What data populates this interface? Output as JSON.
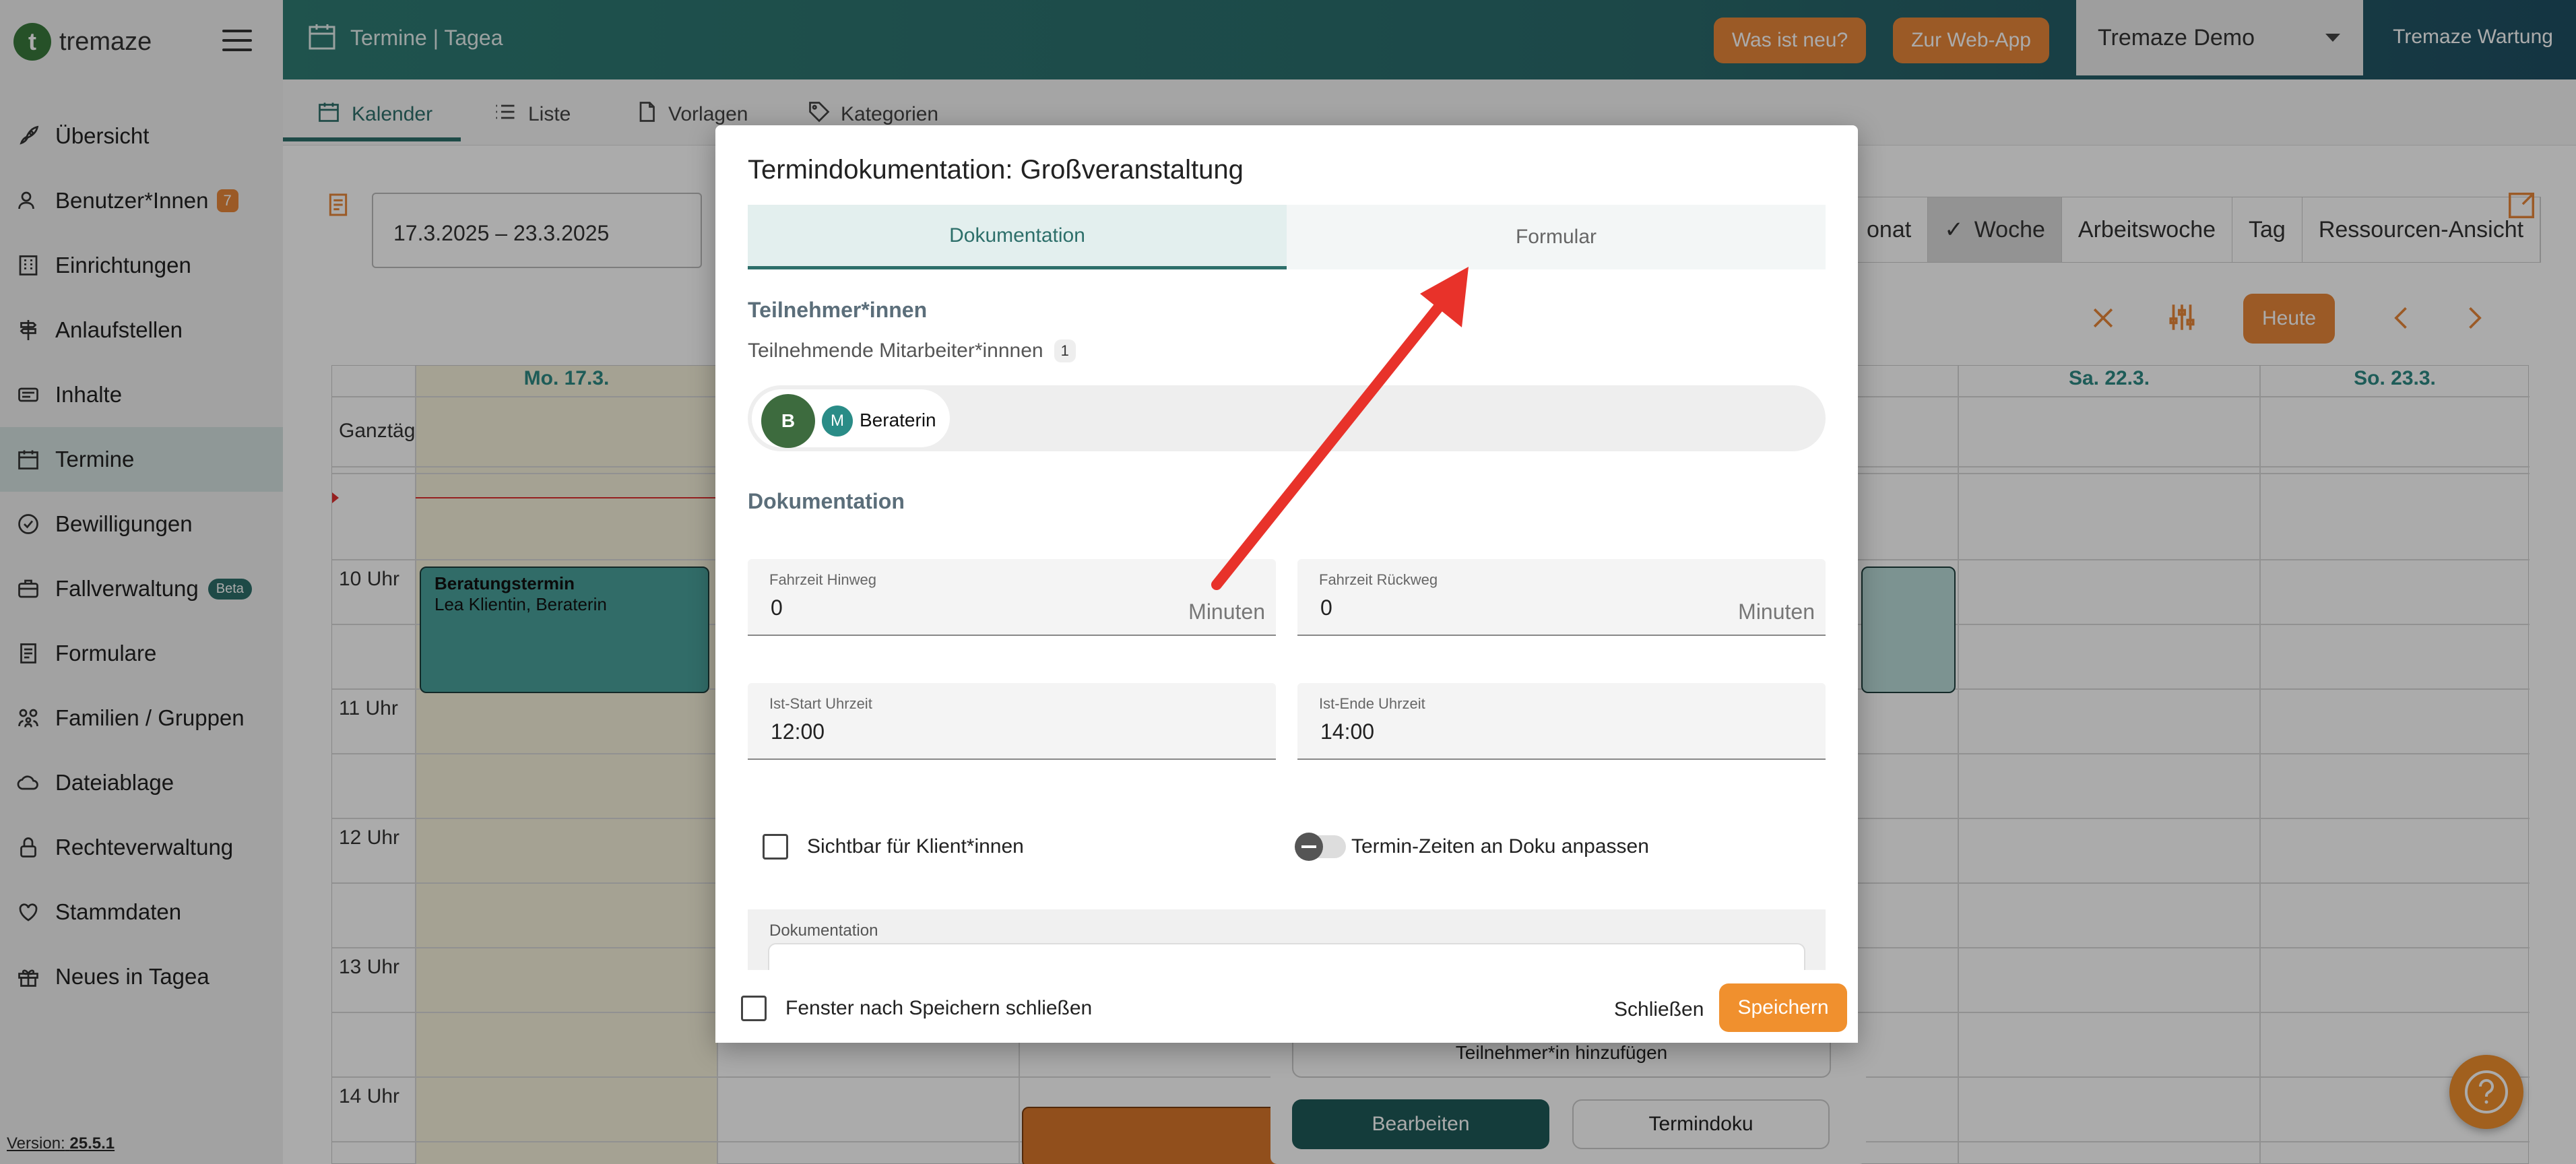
{
  "sidebar": {
    "logo_text": "tremaze",
    "logo_letter": "t",
    "items": [
      {
        "label": "Übersicht",
        "icon": "rocket-icon"
      },
      {
        "label": "Benutzer*Innen",
        "icon": "users-icon",
        "badge": "7"
      },
      {
        "label": "Einrichtungen",
        "icon": "building-icon"
      },
      {
        "label": "Anlaufstellen",
        "icon": "signpost-icon"
      },
      {
        "label": "Inhalte",
        "icon": "content-icon"
      },
      {
        "label": "Termine",
        "icon": "calendar-icon",
        "active": true
      },
      {
        "label": "Bewilligungen",
        "icon": "check-circle-icon"
      },
      {
        "label": "Fallverwaltung",
        "icon": "briefcase-icon",
        "badge": "Beta"
      },
      {
        "label": "Formulare",
        "icon": "form-icon"
      },
      {
        "label": "Familien / Gruppen",
        "icon": "family-icon"
      },
      {
        "label": "Dateiablage",
        "icon": "cloud-icon"
      },
      {
        "label": "Rechteverwaltung",
        "icon": "lock-icon"
      },
      {
        "label": "Stammdaten",
        "icon": "heart-icon"
      },
      {
        "label": "Neues in Tagea",
        "icon": "gift-icon"
      }
    ],
    "version_label": "Version:",
    "version_value": "25.5.1"
  },
  "header": {
    "title": "Termine | Tagea",
    "whats_new": "Was ist neu?",
    "web_app": "Zur Web-App",
    "org_select": "Tremaze Demo",
    "maintenance": "Tremaze Wartung"
  },
  "subtabs": [
    "Kalender",
    "Liste",
    "Vorlagen",
    "Kategorien"
  ],
  "calendar": {
    "date_range": "17.3.2025 – 23.3.2025",
    "views": [
      "onat",
      "Woche",
      "Arbeitswoche",
      "Tag",
      "Ressourcen-Ansicht"
    ],
    "today": "Heute",
    "days": [
      "Mo. 17.3.",
      "Sa. 22.3.",
      "So. 23.3."
    ],
    "allday_label": "Ganztäg",
    "hours": [
      "10 Uhr",
      "11 Uhr",
      "12 Uhr",
      "13 Uhr",
      "14 Uhr"
    ],
    "event_title": "Beratungstermin",
    "event_sub": "Lea Klientin, Beraterin"
  },
  "popover": {
    "add_participant": "Teilnehmer*in hinzufügen",
    "edit": "Bearbeiten",
    "doc": "Termindoku"
  },
  "modal": {
    "title": "Termindokumentation: Großveranstaltung",
    "tabs": [
      "Dokumentation",
      "Formular"
    ],
    "participants_title": "Teilnehmer*innen",
    "staff_label": "Teilnehmende Mitarbeiter*innnen",
    "staff_count": "1",
    "avatar_b": "B",
    "avatar_m": "M",
    "participant_name": "Beraterin",
    "doc_title": "Dokumentation",
    "travel_to_label": "Fahrzeit Hinweg",
    "travel_to_value": "0",
    "travel_back_label": "Fahrzeit Rückweg",
    "travel_back_value": "0",
    "minutes": "Minuten",
    "start_label": "Ist-Start Uhrzeit",
    "start_value": "12:00",
    "end_label": "Ist-Ende Uhrzeit",
    "end_value": "14:00",
    "visible_label": "Sichtbar für Klient*innen",
    "adjust_label": "Termin-Zeiten an Doku anpassen",
    "doc_field_label": "Dokumentation",
    "close_after_save": "Fenster nach Speichern schließen",
    "close": "Schließen",
    "save": "Speichern"
  },
  "colors": {
    "teal": "#2d6f6a",
    "orange": "#e8873a",
    "arrow": "#e8322a"
  }
}
